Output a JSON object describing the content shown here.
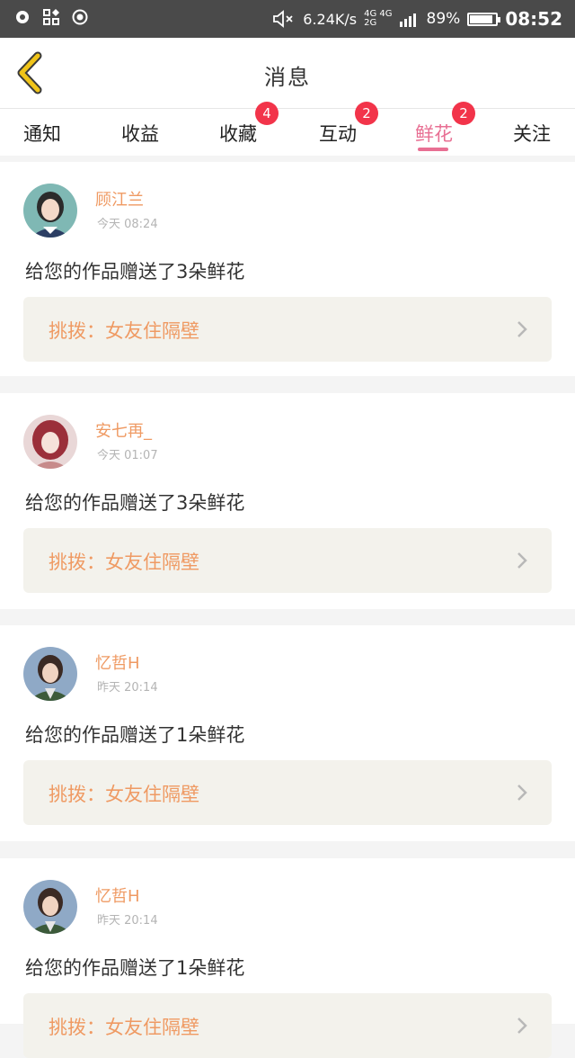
{
  "status_bar": {
    "network_speed": "6.24K/s",
    "network_type_top": "4G 4G",
    "network_type_bottom": "2G",
    "battery_percent": "89%",
    "battery_level": 0.89,
    "time": "08:52"
  },
  "header": {
    "title": "消息",
    "back_icon": "back-chevron-icon"
  },
  "tabs": [
    {
      "label": "通知",
      "badge": ""
    },
    {
      "label": "收益",
      "badge": ""
    },
    {
      "label": "收藏",
      "badge": "4"
    },
    {
      "label": "互动",
      "badge": "2"
    },
    {
      "label": "鲜花",
      "badge": "2",
      "active": true
    },
    {
      "label": "关注",
      "badge": ""
    }
  ],
  "messages": [
    {
      "name": "顾江兰",
      "time": "今天 08:24",
      "text": "给您的作品赠送了3朵鲜花",
      "work": "挑拨：女友住隔壁"
    },
    {
      "name": "安七再_",
      "time": "今天 01:07",
      "text": "给您的作品赠送了3朵鲜花",
      "work": "挑拨：女友住隔壁"
    },
    {
      "name": "忆哲H",
      "time": "昨天 20:14",
      "text": "给您的作品赠送了1朵鲜花",
      "work": "挑拨：女友住隔壁"
    },
    {
      "name": "忆哲H",
      "time": "昨天 20:14",
      "text": "给您的作品赠送了1朵鲜花",
      "work": "挑拨：女友住隔壁"
    }
  ],
  "colors": {
    "accent": "#e86f93",
    "badge": "#f2344a",
    "name": "#ef9a63",
    "back": "#f0c419"
  }
}
